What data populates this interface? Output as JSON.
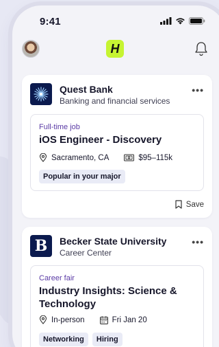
{
  "status_bar": {
    "time": "9:41"
  },
  "header": {
    "logo_text": "H"
  },
  "cards": [
    {
      "org": {
        "name": "Quest Bank",
        "subtitle": "Banking and financial services",
        "logo_icon": "star-burst-icon"
      },
      "listing": {
        "type": "Full-time job",
        "title": "iOS Engineer - Discovery",
        "location": "Sacramento, CA",
        "salary": "$95–115k",
        "tags": [
          "Popular in your major"
        ]
      },
      "save_label": "Save"
    },
    {
      "org": {
        "name": "Becker State University",
        "subtitle": "Career Center",
        "logo_text": "B"
      },
      "listing": {
        "type": "Career fair",
        "title": "Industry Insights: Science & Technology",
        "location": "In-person",
        "date": "Fri Jan 20",
        "tags": [
          "Networking",
          "Hiring"
        ]
      }
    }
  ],
  "colors": {
    "accent": "#c6f432",
    "brand_navy": "#0b1a4e",
    "type_label": "#5a3aa5"
  }
}
